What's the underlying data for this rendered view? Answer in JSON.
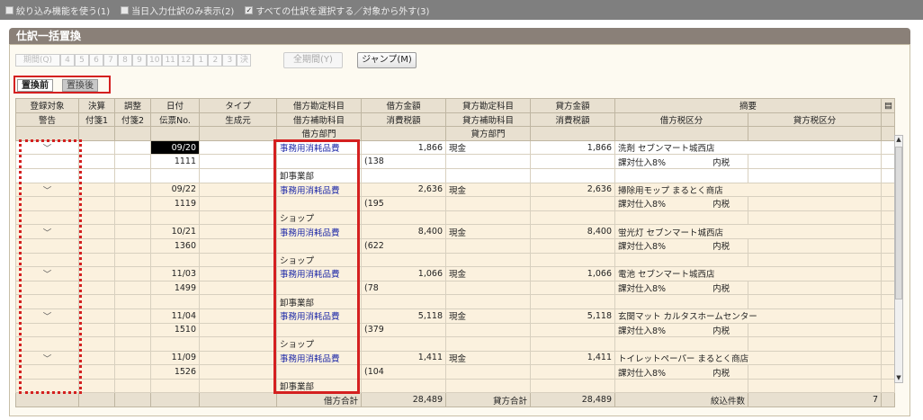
{
  "topbar": {
    "options": [
      {
        "label": "絞り込み機能を使う(1)",
        "checked": false
      },
      {
        "label": "当日入力仕訳のみ表示(2)",
        "checked": false
      },
      {
        "label": "すべての仕訳を選択する／対象から外す(3)",
        "checked": true
      }
    ]
  },
  "title": "仕訳一括置換",
  "periods": [
    "期間(Q)",
    "4",
    "5",
    "6",
    "7",
    "8",
    "9",
    "10",
    "11",
    "12",
    "1",
    "2",
    "3",
    "決"
  ],
  "buttons": {
    "full_period": "全期間(Y)",
    "jump": "ジャンプ(M)"
  },
  "tabs": {
    "before": "置換前",
    "after": "置換後"
  },
  "headers": {
    "row1": [
      "登録対象",
      "決算",
      "調整",
      "日付",
      "タイプ",
      "借方勘定科目",
      "借方金額",
      "貸方勘定科目",
      "貸方金額",
      "摘要"
    ],
    "row2": [
      "警告",
      "付箋1",
      "付箋2",
      "伝票No.",
      "生成元",
      "借方補助科目",
      "消費税額",
      "貸方補助科目",
      "消費税額",
      "借方税区分",
      "貸方税区分"
    ],
    "row3": [
      "借方部門",
      "貸方部門"
    ]
  },
  "entries": [
    {
      "date": "09/20",
      "slip": "1111",
      "debit_account": "事務用消耗品費",
      "debit_dept": "卸事業部",
      "debit_amount": "1,866",
      "tax": "(138",
      "credit_account": "現金",
      "credit_amount": "1,866",
      "memo": "洗剤 セブンマート城西店",
      "tax_category": "課対仕入8%",
      "tax_type": "内税",
      "check": "﹀"
    },
    {
      "date": "09/22",
      "slip": "1119",
      "debit_account": "事務用消耗品費",
      "debit_dept": "ショップ",
      "debit_amount": "2,636",
      "tax": "(195",
      "credit_account": "現金",
      "credit_amount": "2,636",
      "memo": "掃除用モップ まるとく商店",
      "tax_category": "課対仕入8%",
      "tax_type": "内税",
      "check": "﹀"
    },
    {
      "date": "10/21",
      "slip": "1360",
      "debit_account": "事務用消耗品費",
      "debit_dept": "ショップ",
      "debit_amount": "8,400",
      "tax": "(622",
      "credit_account": "現金",
      "credit_amount": "8,400",
      "memo": "蛍光灯 セブンマート城西店",
      "tax_category": "課対仕入8%",
      "tax_type": "内税",
      "check": "﹀"
    },
    {
      "date": "11/03",
      "slip": "1499",
      "debit_account": "事務用消耗品費",
      "debit_dept": "卸事業部",
      "debit_amount": "1,066",
      "tax": "(78",
      "credit_account": "現金",
      "credit_amount": "1,066",
      "memo": "電池 セブンマート城西店",
      "tax_category": "課対仕入8%",
      "tax_type": "内税",
      "check": "﹀"
    },
    {
      "date": "11/04",
      "slip": "1510",
      "debit_account": "事務用消耗品費",
      "debit_dept": "ショップ",
      "debit_amount": "5,118",
      "tax": "(379",
      "credit_account": "現金",
      "credit_amount": "5,118",
      "memo": "玄関マット カルタスホームセンター",
      "tax_category": "課対仕入8%",
      "tax_type": "内税",
      "check": "﹀"
    },
    {
      "date": "11/09",
      "slip": "1526",
      "debit_account": "事務用消耗品費",
      "debit_dept": "卸事業部",
      "debit_amount": "1,411",
      "tax": "(104",
      "credit_account": "現金",
      "credit_amount": "1,411",
      "memo": "トイレットペーパー まるとく商店",
      "tax_category": "課対仕入8%",
      "tax_type": "内税",
      "check": "﹀"
    }
  ],
  "totals": {
    "debit_label": "借方合計",
    "debit_total": "28,489",
    "credit_label": "貸方合計",
    "credit_total": "28,489",
    "count_label": "絞込件数",
    "count": "7"
  }
}
